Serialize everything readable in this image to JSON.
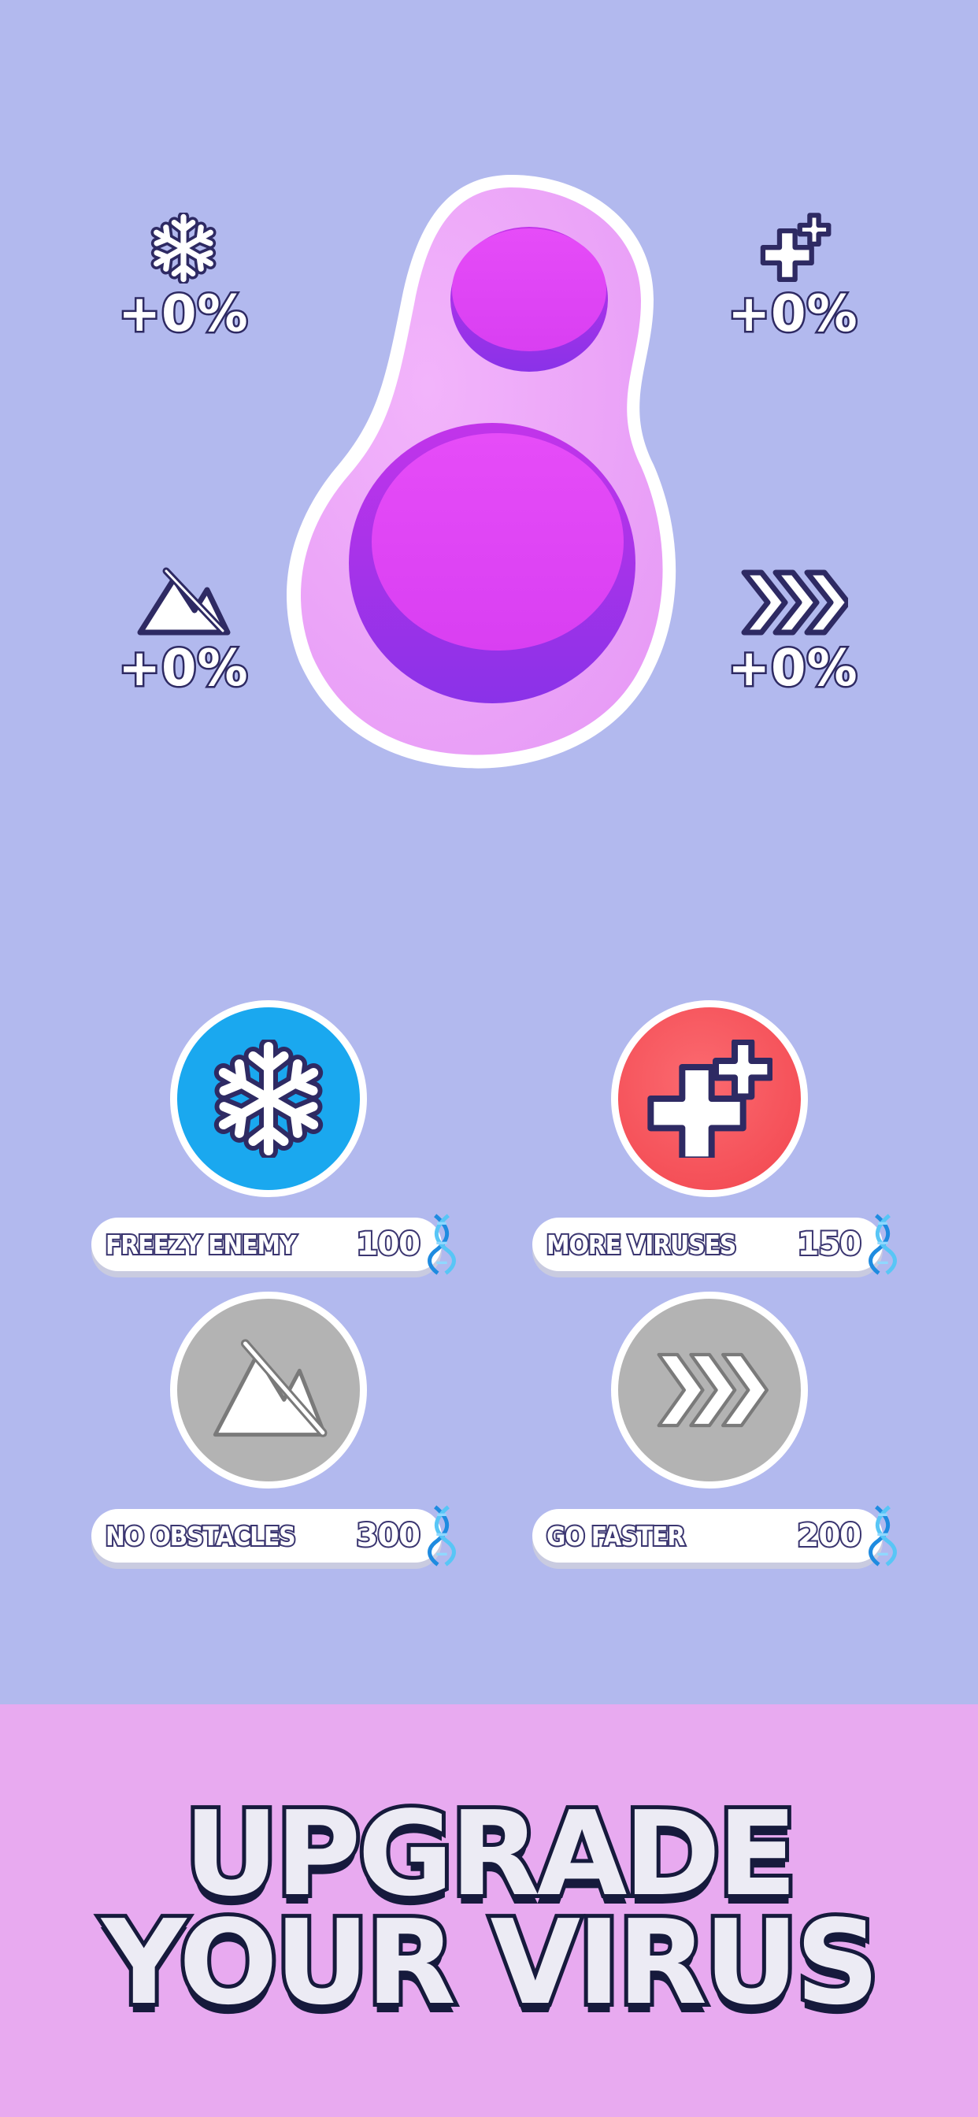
{
  "stats": {
    "freeze": {
      "icon": "snowflake-icon",
      "value": "+0%"
    },
    "viruses": {
      "icon": "plus-icon",
      "value": "+0%"
    },
    "obstacles": {
      "icon": "mountain-icon",
      "value": "+0%"
    },
    "speed": {
      "icon": "chevrons-icon",
      "value": "+0%"
    }
  },
  "upgrades": [
    {
      "name": "FREEZY ENEMY",
      "price": "100",
      "icon": "snowflake-icon",
      "color": "#1aa8ef",
      "active": true
    },
    {
      "name": "MORE VIRUSES",
      "price": "150",
      "icon": "plus-icon",
      "color": "#f7525a",
      "active": true
    },
    {
      "name": "NO OBSTACLES",
      "price": "300",
      "icon": "mountain-icon",
      "color": "#b3b3b3",
      "active": false
    },
    {
      "name": "GO FASTER",
      "price": "200",
      "icon": "chevrons-icon",
      "color": "#b3b3b3",
      "active": false
    }
  ],
  "currency_icon": "dna-icon",
  "headline": {
    "line1": "UPGRADE",
    "line2": "YOUR VIRUS"
  },
  "colors": {
    "background": "#b2b9ee",
    "banner": "#e8aaf0",
    "virus_body": "#efa8fa",
    "virus_core": "#df42f5"
  }
}
